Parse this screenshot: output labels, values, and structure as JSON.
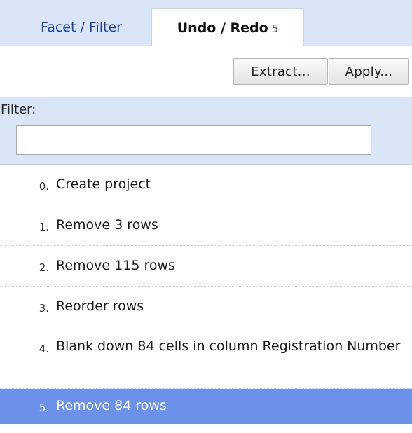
{
  "tabs": {
    "facet_label": "Facet / Filter",
    "undo_label": "Undo / Redo",
    "undo_count": "5"
  },
  "toolbar": {
    "extract_label": "Extract...",
    "apply_label": "Apply..."
  },
  "filter": {
    "label": "Filter:",
    "value": "",
    "placeholder": ""
  },
  "history": {
    "entries": [
      {
        "num": "0.",
        "desc": "Create project"
      },
      {
        "num": "1.",
        "desc": "Remove 3 rows"
      },
      {
        "num": "2.",
        "desc": "Remove 115 rows"
      },
      {
        "num": "3.",
        "desc": "Reorder rows"
      },
      {
        "num": "4.",
        "desc": "Blank down 84 cells in column Registration Number"
      },
      {
        "num": "5.",
        "desc": "Remove 84 rows"
      }
    ],
    "selected_index": 5,
    "selected_color": "#6b91e8"
  },
  "colors": {
    "header_bg": "#dbe5f8",
    "tab_text": "#1d3f95"
  }
}
